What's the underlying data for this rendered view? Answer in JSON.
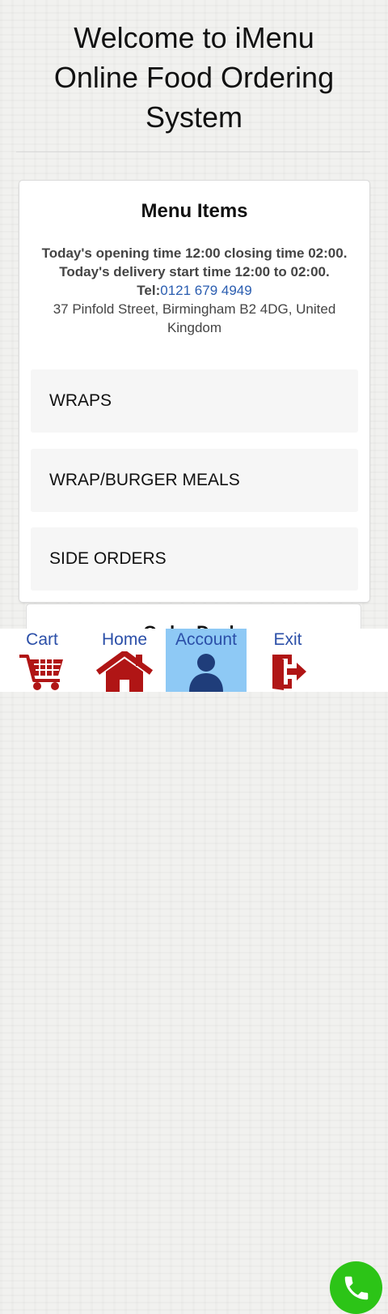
{
  "header": {
    "line1": "Welcome to iMenu",
    "line2": "Online Food Ordering",
    "line3": "System"
  },
  "card": {
    "heading": "Menu Items",
    "opening": "Today's opening time 12:00 closing time 02:00.",
    "delivery": "Today's delivery start time 12:00 to 02:00.",
    "tel_label": "Tel:",
    "tel_number": "0121 679 4949",
    "address": "37 Pinfold Street, Birmingham B2 4DG, United Kingdom",
    "items": [
      {
        "label": "WRAPS"
      },
      {
        "label": "WRAP/BURGER MEALS"
      },
      {
        "label": "SIDE ORDERS"
      }
    ]
  },
  "partial_card": {
    "heading": "Order Deals"
  },
  "nav": {
    "items": [
      {
        "label": "Cart",
        "icon": "cart-icon"
      },
      {
        "label": "Home",
        "icon": "home-icon"
      },
      {
        "label": "Account",
        "icon": "account-icon",
        "active": true
      },
      {
        "label": "Exit",
        "icon": "exit-icon"
      }
    ],
    "call_icon": "phone-icon"
  },
  "colors": {
    "link": "#2a5db0",
    "nav_label": "#2b4fa8",
    "icon_red": "#b01515",
    "active_bg": "#8ec9f5",
    "call_green": "#2cc417"
  }
}
